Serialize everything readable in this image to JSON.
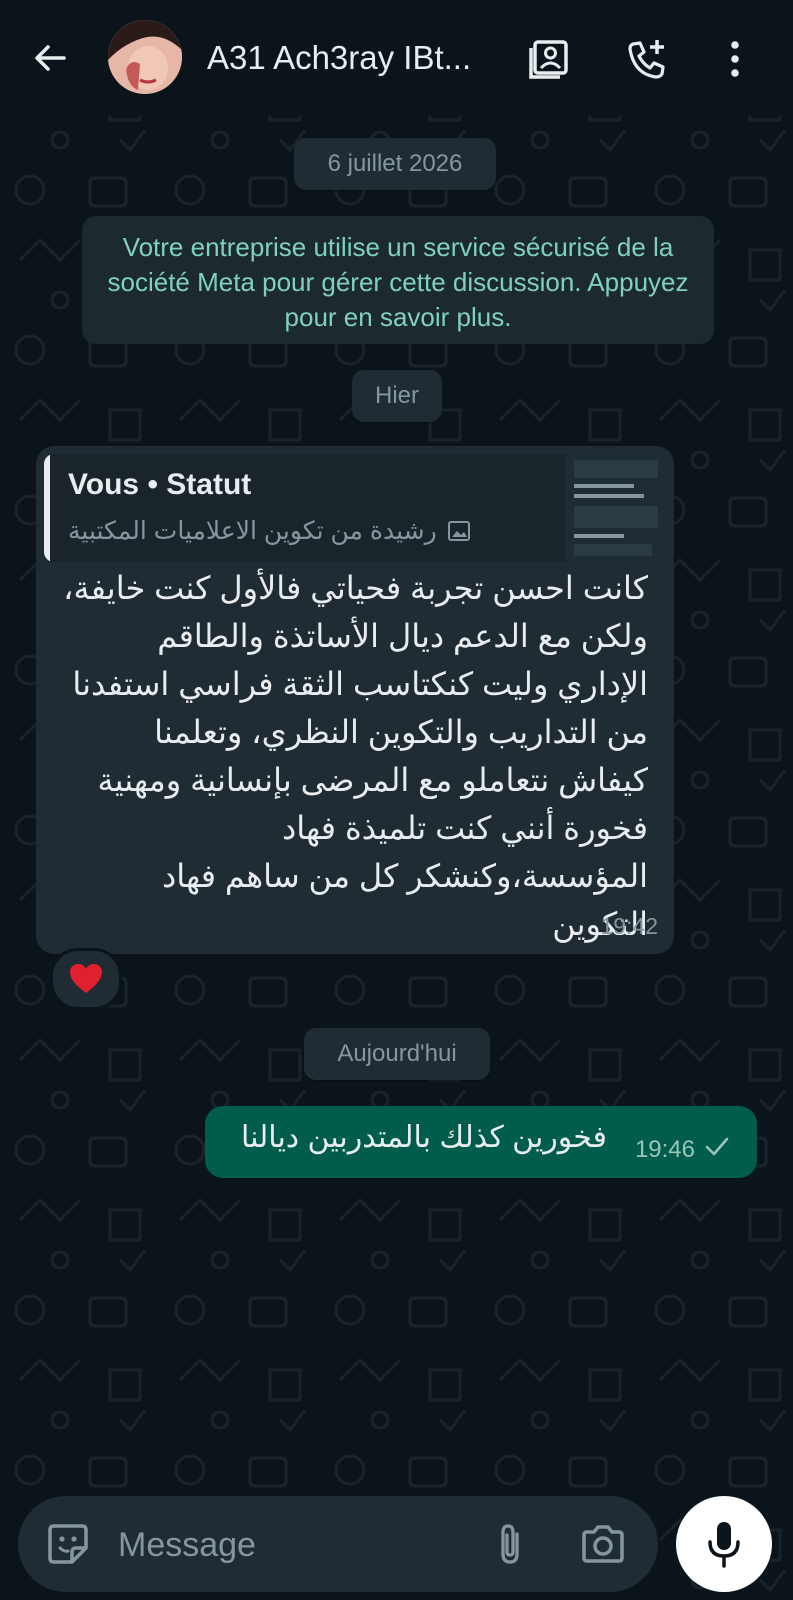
{
  "header": {
    "contact_name": "A31 Ach3ray IBt...",
    "icons": [
      "back-arrow-icon",
      "contact-card-icon",
      "add-call-icon",
      "more-vertical-icon"
    ]
  },
  "chat": {
    "date_chip_1": "6 juillet 2026",
    "system_message": "Votre entreprise utilise un service sécurisé de la société Meta pour gérer cette discussion. Appuyez pour en savoir plus.",
    "date_chip_2": "Hier",
    "incoming": {
      "quote_title": "Vous • Statut",
      "quote_subtitle": "رشيدة من تكوين الاعلاميات المكتبية",
      "text": "كانت احسن تجربة فحياتي فالأول كنت خايفة، ولكن مع الدعم ديال الأساتذة والطاقم الإداري وليت كنكتاسب الثقة فراسي استفدنا من التداريب والتكوين النظري، وتعلمنا كيفاش نتعاملو مع المرضى بإنسانية ومهنية فخورة أنني كنت تلميذة فهاد المؤسسة،وكنشكر كل من ساهم فهاد التكوين",
      "time": "19:42",
      "reaction": "❤️"
    },
    "date_chip_3": "Aujourd'hui",
    "outgoing": {
      "text": "فخورين كذلك بالمتدربين ديالنا",
      "time": "19:46"
    }
  },
  "composer": {
    "placeholder": "Message"
  },
  "colors": {
    "background": "#0b141a",
    "incoming_bubble": "#202c33",
    "outgoing_bubble": "#005c4b",
    "system_text": "#7fd1bd"
  }
}
